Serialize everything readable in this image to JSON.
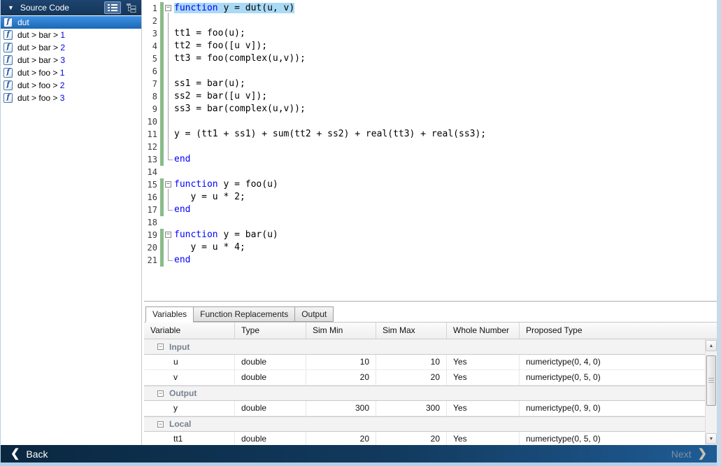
{
  "sidebar": {
    "title": "Source Code",
    "icons": [
      "collapse-triangle-icon",
      "list-view-icon",
      "tree-view-icon",
      "function-icon"
    ],
    "items": [
      {
        "text": "dut",
        "selected": true
      },
      {
        "text": "dut > bar > ",
        "num": "1"
      },
      {
        "text": "dut > bar > ",
        "num": "2"
      },
      {
        "text": "dut > bar > ",
        "num": "3"
      },
      {
        "text": "dut > foo > ",
        "num": "1"
      },
      {
        "text": "dut > foo > ",
        "num": "2"
      },
      {
        "text": "dut > foo > ",
        "num": "3"
      }
    ]
  },
  "editor": {
    "lines": [
      {
        "n": "1",
        "green": true,
        "fold": "start",
        "hl": true,
        "segs": [
          [
            "kw",
            "function"
          ],
          [
            "pl",
            " y = dut(u, v)"
          ]
        ]
      },
      {
        "n": "2",
        "green": true,
        "fold": "mid",
        "segs": []
      },
      {
        "n": "3",
        "green": true,
        "fold": "mid",
        "segs": [
          [
            "pl",
            "tt1 = foo(u);"
          ]
        ]
      },
      {
        "n": "4",
        "green": true,
        "fold": "mid",
        "segs": [
          [
            "pl",
            "tt2 = foo([u v]);"
          ]
        ]
      },
      {
        "n": "5",
        "green": true,
        "fold": "mid",
        "segs": [
          [
            "pl",
            "tt3 = foo(complex(u,v));"
          ]
        ]
      },
      {
        "n": "6",
        "green": true,
        "fold": "mid",
        "segs": []
      },
      {
        "n": "7",
        "green": true,
        "fold": "mid",
        "segs": [
          [
            "pl",
            "ss1 = bar(u);"
          ]
        ]
      },
      {
        "n": "8",
        "green": true,
        "fold": "mid",
        "segs": [
          [
            "pl",
            "ss2 = bar([u v]);"
          ]
        ]
      },
      {
        "n": "9",
        "green": true,
        "fold": "mid",
        "segs": [
          [
            "pl",
            "ss3 = bar(complex(u,v));"
          ]
        ]
      },
      {
        "n": "10",
        "green": true,
        "fold": "mid",
        "segs": []
      },
      {
        "n": "11",
        "green": true,
        "fold": "mid",
        "segs": [
          [
            "pl",
            "y = (tt1 + ss1) + sum(tt2 + ss2) + real(tt3) + real(ss3);"
          ]
        ]
      },
      {
        "n": "12",
        "green": true,
        "fold": "mid",
        "segs": []
      },
      {
        "n": "13",
        "green": true,
        "fold": "end",
        "segs": [
          [
            "kw",
            "end"
          ]
        ]
      },
      {
        "n": "14",
        "green": false,
        "fold": null,
        "segs": []
      },
      {
        "n": "15",
        "green": true,
        "fold": "start",
        "segs": [
          [
            "kw",
            "function"
          ],
          [
            "pl",
            " y = foo(u)"
          ]
        ]
      },
      {
        "n": "16",
        "green": true,
        "fold": "mid",
        "segs": [
          [
            "pl",
            "   y = u * 2;"
          ]
        ]
      },
      {
        "n": "17",
        "green": true,
        "fold": "end",
        "segs": [
          [
            "kw",
            "end"
          ]
        ]
      },
      {
        "n": "18",
        "green": false,
        "fold": null,
        "segs": []
      },
      {
        "n": "19",
        "green": true,
        "fold": "start",
        "segs": [
          [
            "kw",
            "function"
          ],
          [
            "pl",
            " y = bar(u)"
          ]
        ]
      },
      {
        "n": "20",
        "green": true,
        "fold": "mid",
        "segs": [
          [
            "pl",
            "   y = u * 4;"
          ]
        ]
      },
      {
        "n": "21",
        "green": true,
        "fold": "end",
        "segs": [
          [
            "kw",
            "end"
          ]
        ]
      }
    ]
  },
  "tabs": {
    "items": [
      {
        "label": "Variables",
        "active": true
      },
      {
        "label": "Function Replacements",
        "active": false
      },
      {
        "label": "Output",
        "active": false
      }
    ]
  },
  "table": {
    "columns": [
      "Variable",
      "Type",
      "Sim Min",
      "Sim Max",
      "Whole Number",
      "Proposed Type"
    ],
    "rows": [
      {
        "group": "Input"
      },
      {
        "cells": [
          "u",
          "double",
          "10",
          "10",
          "Yes",
          "numerictype(0, 4, 0)"
        ]
      },
      {
        "cells": [
          "v",
          "double",
          "20",
          "20",
          "Yes",
          "numerictype(0, 5, 0)"
        ]
      },
      {
        "group": "Output"
      },
      {
        "cells": [
          "y",
          "double",
          "300",
          "300",
          "Yes",
          "numerictype(0, 9, 0)"
        ]
      },
      {
        "group": "Local"
      },
      {
        "cells": [
          "tt1",
          "double",
          "20",
          "20",
          "Yes",
          "numerictype(0, 5, 0)"
        ]
      }
    ]
  },
  "footer": {
    "back_label": "Back",
    "next_label": "Next"
  },
  "colors": {
    "sidebar_header_bg": "#16395d",
    "selection_blue": "#2e81d6",
    "keyword_blue": "#0000ff",
    "coverage_green": "#8abb8a",
    "line_highlight": "#aadaf6",
    "footer_dark": "#0a2740",
    "footer_light": "#1f5c95",
    "window_border": "#c5daeb"
  }
}
